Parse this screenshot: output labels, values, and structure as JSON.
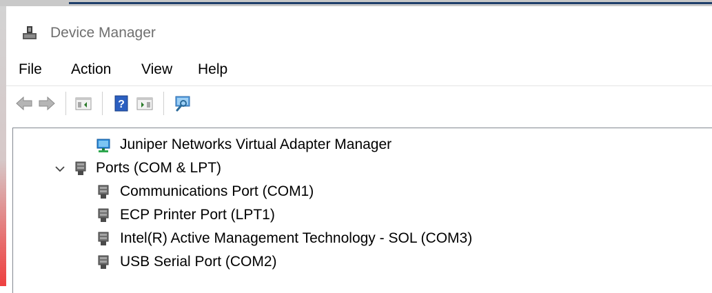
{
  "window": {
    "title": "Device Manager"
  },
  "menu": [
    "File",
    "Action",
    "View",
    "Help"
  ],
  "toolbar": {
    "buttons": [
      {
        "icon": "back-arrow-icon"
      },
      {
        "icon": "forward-arrow-icon"
      },
      {
        "icon": "show-hide-console-tree-icon"
      },
      {
        "icon": "help-icon"
      },
      {
        "icon": "show-hide-action-pane-icon"
      },
      {
        "icon": "scan-hardware-changes-icon"
      }
    ]
  },
  "tree": {
    "partial_top_item": "Juniper Networks Virtual Adapter Manager",
    "ports_category": "Ports (COM & LPT)",
    "ports": [
      "Communications Port (COM1)",
      "ECP Printer Port (LPT1)",
      "Intel(R) Active Management Technology - SOL (COM3)",
      "USB Serial Port (COM2)"
    ]
  }
}
